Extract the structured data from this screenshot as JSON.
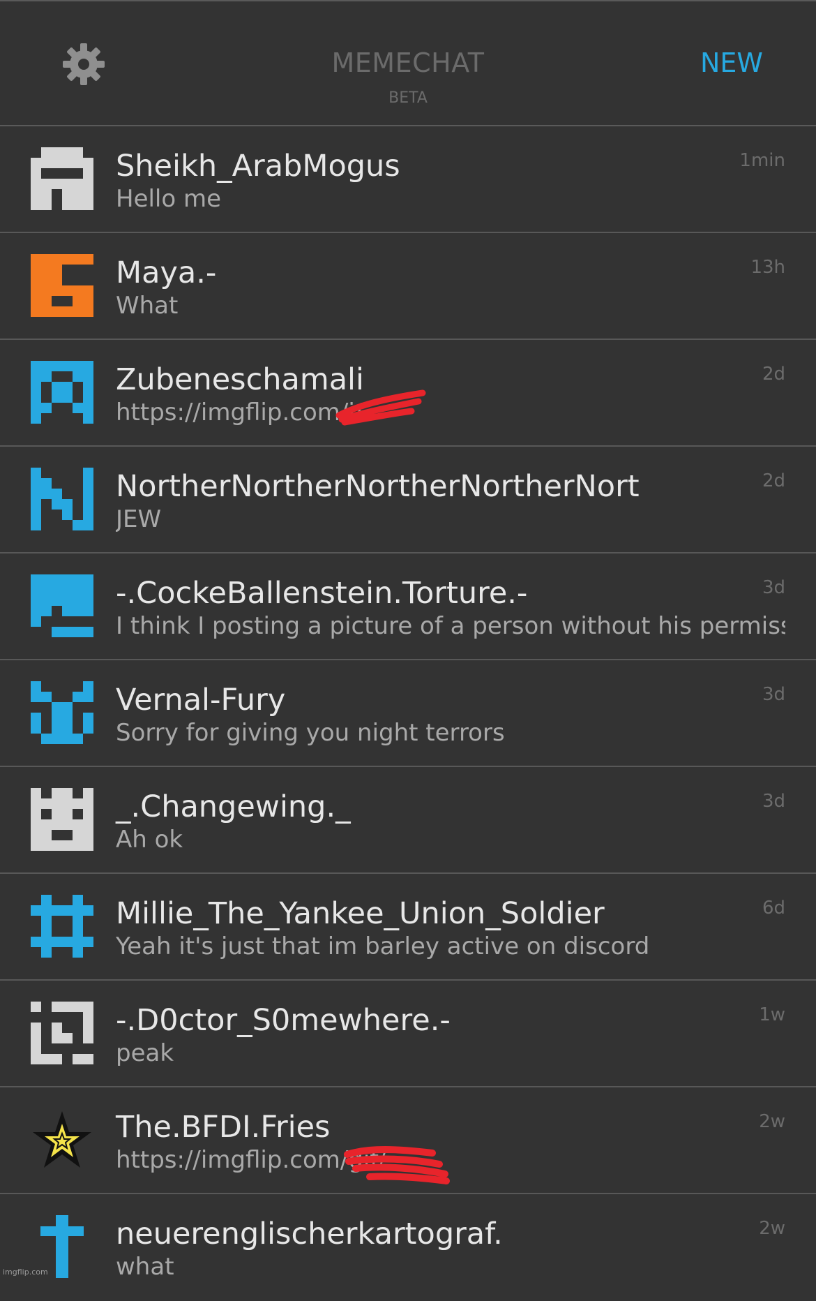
{
  "header": {
    "settings_icon": "gear-icon",
    "title": "MEMECHAT",
    "subtitle": "BETA",
    "new_label": "NEW"
  },
  "colors": {
    "background": "#333333",
    "accent_blue": "#27a9e1",
    "orange": "#f47a20",
    "light_gray": "#d6d6d6",
    "divider": "#585858",
    "redaction": "#e8242b"
  },
  "chats": [
    {
      "name": "Sheikh_ArabMogus",
      "message": "Hello me",
      "time": "1min",
      "avatar": "gray-pixel-avatar"
    },
    {
      "name": "Maya.-",
      "message": "What",
      "time": "13h",
      "avatar": "orange-pixel-avatar"
    },
    {
      "name": "Zubeneschamali",
      "message": "https://imgflip.com/i/",
      "time": "2d",
      "avatar": "blue-pixel-avatar"
    },
    {
      "name": "NortherNortherNortherNortherNort",
      "message": "JEW",
      "time": "2d",
      "avatar": "blue-pixel-avatar"
    },
    {
      "name": "-.CockeBallenstein.Torture.-",
      "message": "I think I posting a picture of a person without his permission i",
      "time": "3d",
      "avatar": "blue-pixel-avatar"
    },
    {
      "name": "Vernal-Fury",
      "message": "Sorry for giving you night terrors",
      "time": "3d",
      "avatar": "blue-pixel-avatar"
    },
    {
      "name": "_.Changewing._",
      "message": "Ah ok",
      "time": "3d",
      "avatar": "gray-pixel-avatar"
    },
    {
      "name": "Millie_The_Yankee_Union_Soldier",
      "message": "Yeah it's just that im barley active on discord",
      "time": "6d",
      "avatar": "blue-pixel-avatar"
    },
    {
      "name": "-.D0ctor_S0mewhere.-",
      "message": "peak",
      "time": "1w",
      "avatar": "gray-pixel-avatar"
    },
    {
      "name": "The.BFDI.Fries",
      "message": "https://imgflip.com/gif/",
      "time": "2w",
      "avatar": "star-avatar"
    },
    {
      "name": "neuerenglischerkartograf.",
      "message": "what",
      "time": "2w",
      "avatar": "cross-avatar"
    }
  ],
  "watermark": "imgflip.com"
}
